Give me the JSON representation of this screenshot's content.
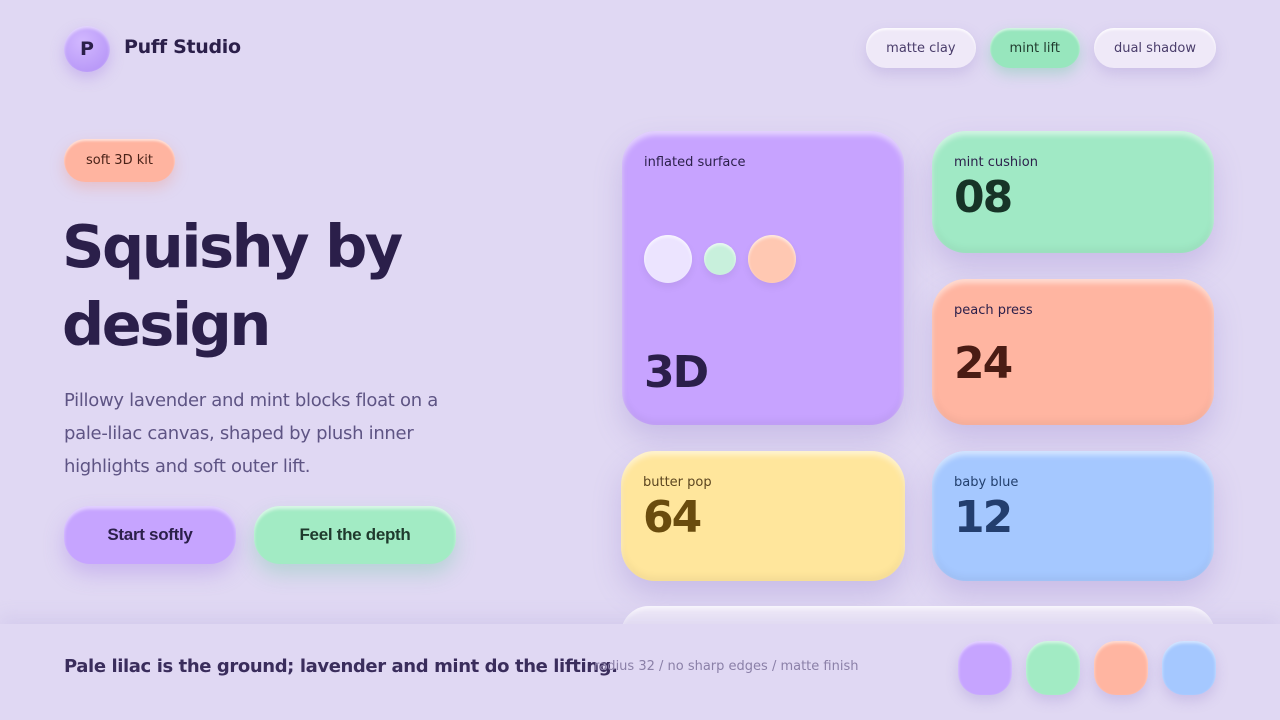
{
  "header": {
    "logo_letter": "P",
    "brand": "Puff Studio",
    "pills": [
      "matte clay",
      "mint lift",
      "dual shadow"
    ]
  },
  "hero": {
    "tag": "soft 3D kit",
    "headline": "Squishy by design",
    "subtext": "Pillowy lavender and mint blocks float on a pale-lilac canvas, shaped by plush inner highlights and soft outer lift.",
    "primary_button": "Start softly",
    "secondary_button": "Feel the depth"
  },
  "cards": {
    "lavender": {
      "label": "inflated surface",
      "value": "3D",
      "color": "#c7a3ff"
    },
    "mint": {
      "label": "mint cushion",
      "value": "08",
      "color": "#a0e9c5"
    },
    "peach": {
      "label": "peach press",
      "value": "24",
      "color": "#ffb5a1"
    },
    "butter": {
      "label": "butter pop",
      "value": "64",
      "color": "#ffe69c"
    },
    "blue": {
      "label": "baby blue",
      "value": "12",
      "color": "#a5c8ff"
    }
  },
  "footer": {
    "tagline": "Pale lilac is the ground; lavender and mint do the lifting.",
    "meta": "radius 32 / no sharp edges / matte finish",
    "swatches": [
      "#c6a4ff",
      "#a2ebc4",
      "#ffb5a1",
      "#a5c8ff"
    ]
  },
  "colors": {
    "background": "#e0d8f3",
    "ink": "#2b1f4a",
    "lavender": "#c6a4ff",
    "mint": "#a2ebc4"
  }
}
